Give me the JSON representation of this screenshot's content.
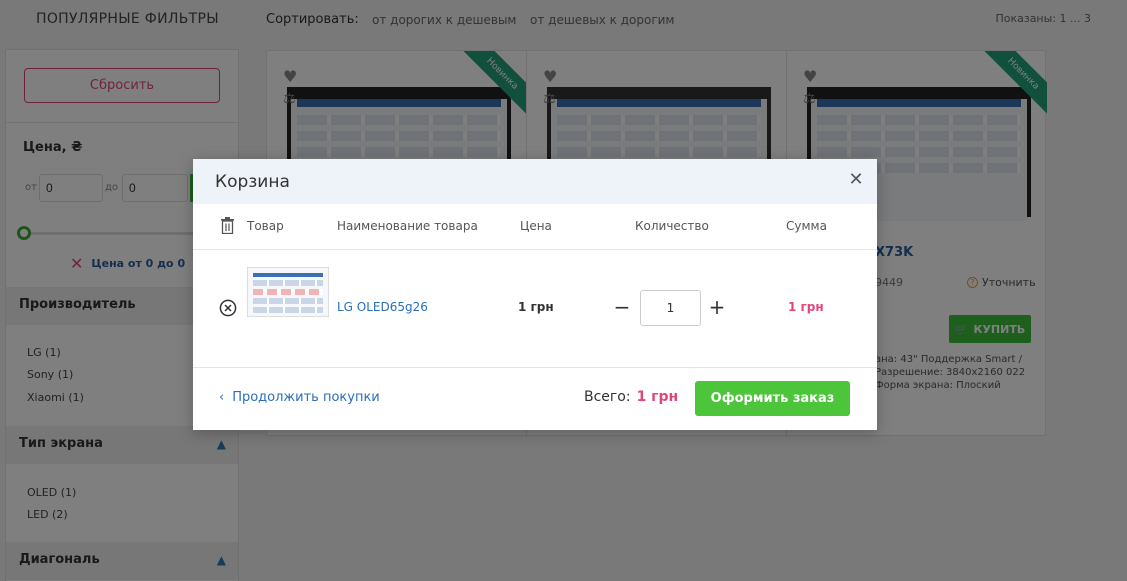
{
  "page": {
    "filters_title": "ПОПУЛЯРНЫЕ ФИЛЬТРЫ",
    "sort_label": "Сортировать:",
    "sort_options": [
      "от дорогих к дешевым",
      "от дешевых к дорогим"
    ],
    "shown": "Показаны: 1 ... 3"
  },
  "sidebar": {
    "reset_label": "Сбросить",
    "price_title": "Цена, ₴",
    "from_label": "от",
    "to_label": "до",
    "from_value": "0",
    "to_value": "0",
    "price_range_text": "Цена от 0 до 0",
    "groups": [
      {
        "title": "Производитель",
        "items": [
          "LG (1)",
          "Sony (1)",
          "Xiaomi (1)"
        ]
      },
      {
        "title": "Тип экрана",
        "items": [
          "OLED (1)",
          "LED (2)"
        ]
      },
      {
        "title": "Диагональ",
        "items": []
      }
    ]
  },
  "cards": {
    "ribbon": "Новинка",
    "card3": {
      "title": "X73K",
      "code": "9449",
      "ask": "Уточнить",
      "buy": "КУПИТЬ",
      "desc": "ана: 43\" Поддержка Smart / Разрешение: 3840x2160 022 Форма экрана: Плоский"
    }
  },
  "cart": {
    "title": "Корзина",
    "columns": {
      "product": "Товар",
      "name": "Наименование товара",
      "price": "Цена",
      "quantity": "Количество",
      "sum": "Сумма"
    },
    "items": [
      {
        "name": "LG OLED65g26",
        "price": "1 грн",
        "quantity": "1",
        "sum": "1 грн"
      }
    ],
    "continue_label": "Продолжить покупки",
    "total_label": "Всего:",
    "total_value": "1 грн",
    "checkout_label": "Оформить заказ"
  },
  "colors": {
    "accent_pink": "#e0457b",
    "link_blue": "#2a6fb8",
    "button_green": "#4cc53a",
    "header_bg": "#eef3fa"
  }
}
